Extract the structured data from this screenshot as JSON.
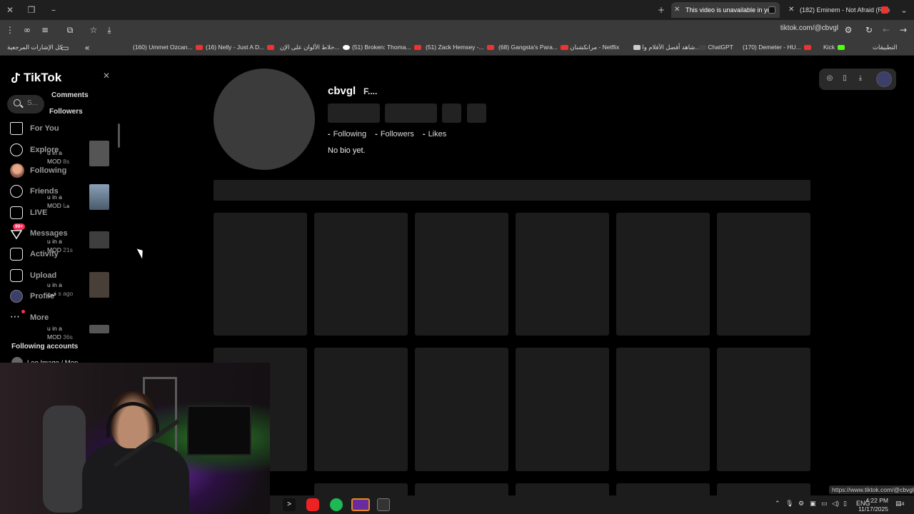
{
  "browser": {
    "tabs": [
      {
        "label": "This video is unavailable in you",
        "active": true
      },
      {
        "label": "(182) Eminem - Not Afraid (Ren",
        "active": false
      }
    ],
    "url": "tiktok.com/@cbvgl",
    "bookmarks": [
      "كل الإشارات المرجعية",
      "(160) Ummet Ozcan...",
      "(16) Nelly - Just A D...",
      "خلاط الألوان على الإن...",
      "(51) Broken: Thoma...",
      "(51) Zack Hemsey -...",
      "(68) Gangsta's Para...",
      "مرانكشنان - Netflix",
      "شاهد أفضل الأفلام وا...",
      "ChatGPT",
      "(170) Demeter - HU...",
      "Kick",
      "التطبيقات"
    ],
    "status_url": "https://www.tiktok.com/@cbvgl"
  },
  "sidebar": {
    "logo": "TikTok",
    "search_placeholder": "S...",
    "popup_tabs": [
      "Comments",
      "Followers"
    ],
    "nav": [
      {
        "label": "For You",
        "icon": "home-icon"
      },
      {
        "label": "Explore",
        "icon": "compass-icon"
      },
      {
        "label": "Following",
        "icon": "avatar"
      },
      {
        "label": "Friends",
        "icon": "friends-icon"
      },
      {
        "label": "LIVE",
        "icon": "live-icon"
      },
      {
        "label": "Messages",
        "icon": "messages-icon",
        "badge": "99+"
      },
      {
        "label": "Activity",
        "icon": "activity-icon"
      },
      {
        "label": "Upload",
        "icon": "upload-icon"
      },
      {
        "label": "Profile",
        "icon": "profile-icon"
      },
      {
        "label": "More",
        "icon": "more-icon"
      }
    ],
    "activity": [
      {
        "line1": "u in a",
        "line2": "MOD",
        "time": "8s"
      },
      {
        "line1": "u in a",
        "line2": "MOD",
        "time": "هنا"
      },
      {
        "line1": "u in a",
        "line2": "MOD",
        "time": "21s"
      },
      {
        "line1": "u in a",
        "line2": "فين",
        "time": "s ago"
      },
      {
        "line1": "u in a",
        "line2": "MOD",
        "time": "36s"
      }
    ],
    "following_accounts_title": "Following accounts",
    "following_accounts": [
      "Leo Image / Men..."
    ]
  },
  "profile": {
    "username": "cbvgl",
    "nickname": "F....",
    "stats": [
      {
        "num": "-",
        "label": "Following"
      },
      {
        "num": "-",
        "label": "Followers"
      },
      {
        "num": "-",
        "label": "Likes"
      }
    ],
    "bio": "No bio yet."
  },
  "taskbar": {
    "lang": "ENG",
    "time": "4:22 PM",
    "date": "11/17/2025",
    "notifications": "4"
  }
}
